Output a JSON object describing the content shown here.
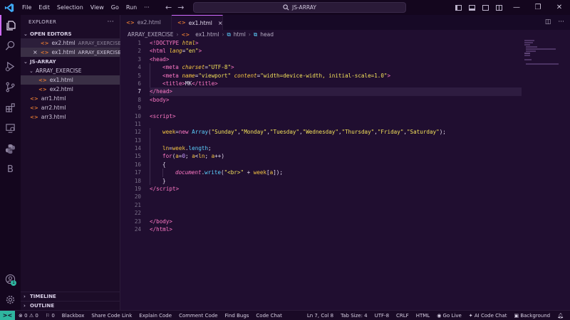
{
  "titlebar": {
    "menu": [
      "File",
      "Edit",
      "Selection",
      "View",
      "Go",
      "Run"
    ],
    "more": "···",
    "search_text": "JS-ARRAY"
  },
  "sidebar": {
    "header": "EXPLORER",
    "more": "···",
    "open_editors_title": "OPEN EDITORS",
    "open_editors": [
      {
        "name": "ex2.html",
        "folder": "ARRAY_EXERCISE"
      },
      {
        "name": "ex1.html",
        "folder": "ARRAY_EXERCISE"
      }
    ],
    "project_title": "JS-ARRAY",
    "folder": "ARRAY_EXERCISE",
    "folder_files": [
      "ex1.html",
      "ex2.html"
    ],
    "root_files": [
      "arr1.html",
      "arr2.html",
      "arr3.html"
    ],
    "timeline": "TIMELINE",
    "outline": "OUTLINE"
  },
  "tabs": [
    {
      "label": "ex2.html",
      "active": false
    },
    {
      "label": "ex1.html",
      "active": true
    }
  ],
  "breadcrumb": [
    "ARRAY_EXERCISE",
    "ex1.html",
    "html",
    "head"
  ],
  "editor": {
    "current_line": 7,
    "line_numbers": [
      "1",
      "2",
      "3",
      "4",
      "5",
      "6",
      "7",
      "8",
      "9",
      "10",
      "11",
      "12",
      "13",
      "14",
      "15",
      "16",
      "17",
      "18",
      "19",
      "20",
      "21",
      "22",
      "23",
      "24"
    ]
  },
  "statusbar": {
    "remote": "><",
    "errors": "0",
    "warnings": "0",
    "info": "0",
    "items": [
      "Blackbox",
      "Share Code Link",
      "Explain Code",
      "Comment Code",
      "Find Bugs",
      "Code Chat"
    ],
    "position": "Ln 7, Col 8",
    "tab_size": "Tab Size: 4",
    "encoding": "UTF-8",
    "eol": "CRLF",
    "language": "HTML",
    "go_live": "Go Live",
    "ai_chat": "AI Code Chat",
    "background": "Background"
  },
  "colors": {
    "accent": "#d06bff",
    "background": "#200e30",
    "status_remote": "#2fb6a0"
  },
  "icons": [
    "explorer-icon",
    "search-icon",
    "run-debug-icon",
    "source-control-icon",
    "extensions-icon",
    "remote-explorer-icon",
    "python-icon",
    "blackbox-icon",
    "account-icon",
    "settings-gear-icon"
  ]
}
